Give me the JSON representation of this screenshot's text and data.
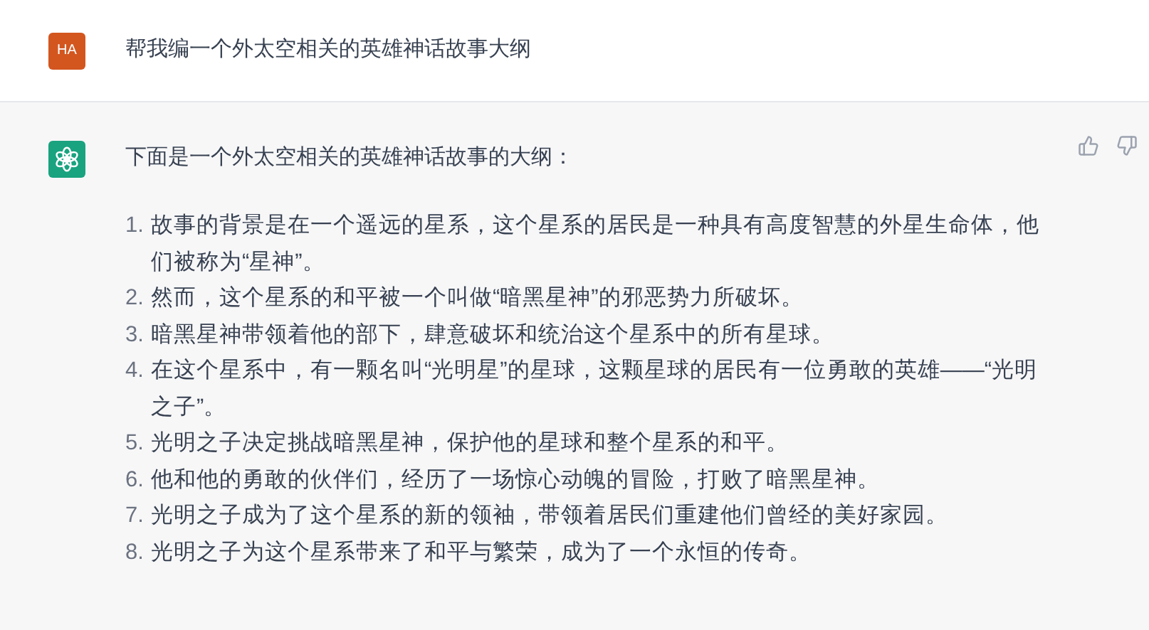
{
  "user_message": {
    "avatar": "HA",
    "text": "帮我编一个外太空相关的英雄神话故事大纲"
  },
  "assistant_message": {
    "intro": "下面是一个外太空相关的英雄神话故事的大纲：",
    "items": [
      {
        "number": "1.",
        "text": "故事的背景是在一个遥远的星系，这个星系的居民是一种具有高度智慧的外星生命体，他们被称为“星神”。"
      },
      {
        "number": "2.",
        "text": "然而，这个星系的和平被一个叫做“暗黑星神”的邪恶势力所破坏。"
      },
      {
        "number": "3.",
        "text": "暗黑星神带领着他的部下，肆意破坏和统治这个星系中的所有星球。"
      },
      {
        "number": "4.",
        "text": "在这个星系中，有一颗名叫“光明星”的星球，这颗星球的居民有一位勇敢的英雄——“光明之子”。"
      },
      {
        "number": "5.",
        "text": "光明之子决定挑战暗黑星神，保护他的星球和整个星系的和平。"
      },
      {
        "number": "6.",
        "text": "他和他的勇敢的伙伴们，经历了一场惊心动魄的冒险，打败了暗黑星神。"
      },
      {
        "number": "7.",
        "text": "光明之子成为了这个星系的新的领袖，带领着居民们重建他们曾经的美好家园。"
      },
      {
        "number": "8.",
        "text": "光明之子为这个星系带来了和平与繁荣，成为了一个永恒的传奇。"
      }
    ]
  }
}
